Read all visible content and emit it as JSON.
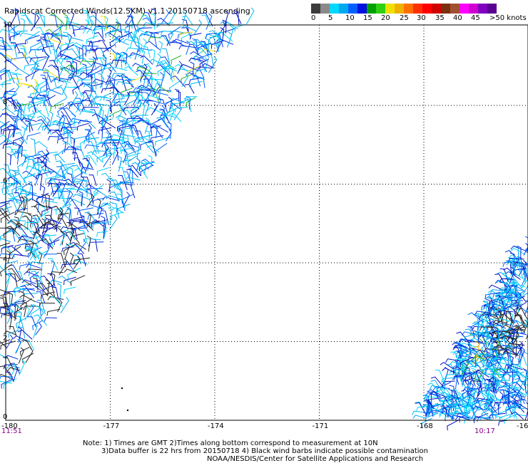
{
  "title": "Rapidscat Corrected Winds(12.5KM) v1.1 20150718 ascending",
  "colorbar": {
    "colors": [
      "#3c3c3c",
      "#8a8a8a",
      "#00d8ff",
      "#00a8f0",
      "#0060ff",
      "#0010e0",
      "#00a000",
      "#30d010",
      "#f0e000",
      "#f0b000",
      "#ff7000",
      "#ff3000",
      "#ff0000",
      "#d00000",
      "#7a3010",
      "#a05030",
      "#ff00ff",
      "#d000d0",
      "#8000c0",
      "#5a0090"
    ],
    "labels": [
      "0",
      "5",
      "10",
      "15",
      "20",
      "25",
      "30",
      "35",
      "40",
      "45",
      ">50 knots"
    ]
  },
  "map": {
    "lon_ticks": [
      "-180",
      "-177",
      "-174",
      "-171",
      "-168",
      "-16"
    ],
    "lat_ticks": [
      "0",
      "2",
      "4",
      "6",
      "8",
      "10"
    ],
    "lon_range": [
      -180,
      -165
    ],
    "lat_range": [
      0,
      10
    ]
  },
  "times": {
    "left": "11:51",
    "right": "10:17"
  },
  "notes": {
    "line1": "Note: 1) Times are GMT 2)Times along bottom correspond to measurement at 10N",
    "line2": "3)Data buffer is 22 hrs from 20150718 4) Black wind barbs indicate possible contamination",
    "line3": "NOAA/NESDIS/Center for Satellite Applications and Research"
  }
}
